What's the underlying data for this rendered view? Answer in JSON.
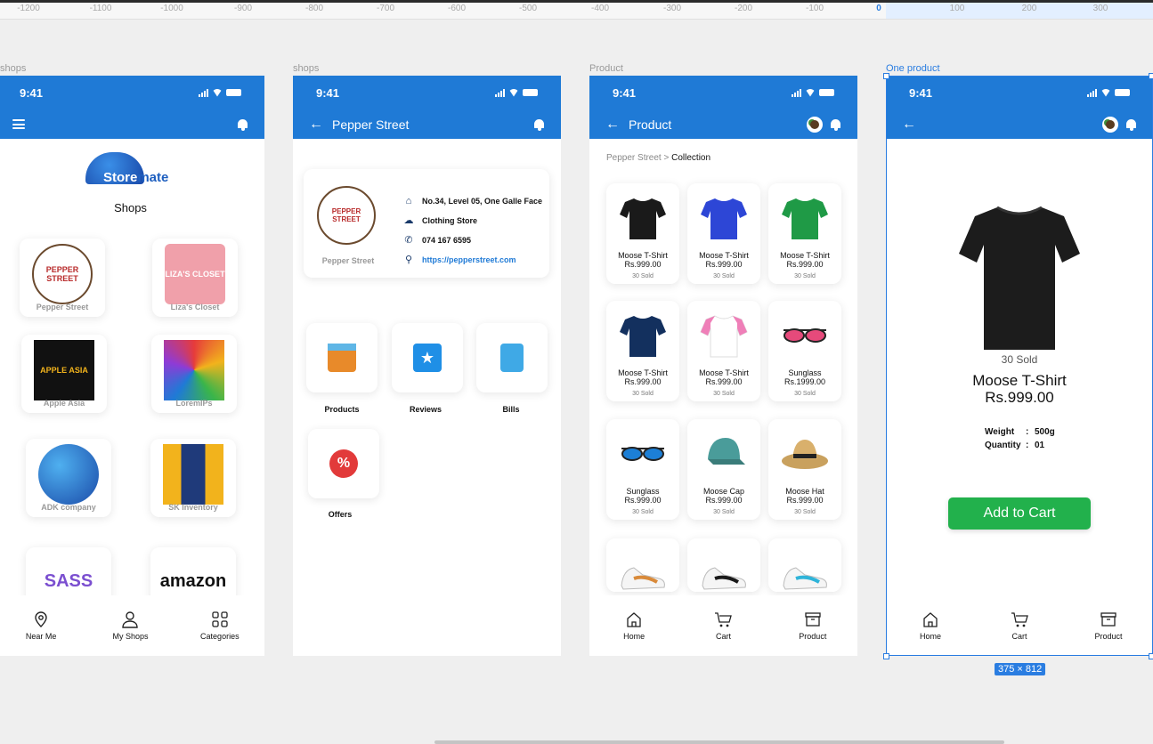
{
  "ruler": {
    "ticks": [
      "-1200",
      "-1100",
      "-1000",
      "-900",
      "-800",
      "-700",
      "-600",
      "-500",
      "-400",
      "-300",
      "-200",
      "-100",
      "0",
      "100",
      "200",
      "300"
    ]
  },
  "frames": [
    {
      "label": "shops"
    },
    {
      "label": "shops"
    },
    {
      "label": "Product"
    },
    {
      "label": "One product"
    }
  ],
  "status_time": "9:41",
  "colors": {
    "primary": "#1f7ad6",
    "cart_button": "#22b14c",
    "selection": "#2a7de1"
  },
  "home": {
    "logo_store": "Store",
    "logo_mate": "mate",
    "title": "Shops",
    "shops": [
      {
        "name": "Pepper Street",
        "logo_text": "PEPPER STREET"
      },
      {
        "name": "Liza's Closet",
        "logo_text": "LIZA'S CLOSET"
      },
      {
        "name": "Apple Asia",
        "logo_text": "APPLE ASIA"
      },
      {
        "name": "LoremIPs",
        "logo_text": ""
      },
      {
        "name": "ADK company",
        "logo_text": ""
      },
      {
        "name": "SK Inventory",
        "logo_text": ""
      },
      {
        "name": "",
        "logo_text": "SASS"
      },
      {
        "name": "",
        "logo_text": "amazon"
      }
    ],
    "nav": [
      {
        "label": "Near Me",
        "icon": "map-pin-icon"
      },
      {
        "label": "My Shops",
        "icon": "user-icon"
      },
      {
        "label": "Categories",
        "icon": "grid-icon"
      }
    ]
  },
  "shop_page": {
    "title": "Pepper Street",
    "logo_caption": "Pepper Street",
    "logo_text": "PEPPER STREET",
    "address": "No.34, Level 05, One Galle Face",
    "category": "Clothing Store",
    "phone": "074 167 6595",
    "website": "https://pepperstreet.com",
    "tiles": [
      {
        "label": "Products",
        "icon": "box-icon"
      },
      {
        "label": "Reviews",
        "icon": "star-chat-icon"
      },
      {
        "label": "Bills",
        "icon": "document-icon"
      },
      {
        "label": "Offers",
        "icon": "percent-icon"
      }
    ]
  },
  "product_list": {
    "title": "Product",
    "breadcrumb_parent": "Pepper Street",
    "breadcrumb_sep": ">",
    "breadcrumb_current": "Collection",
    "items": [
      {
        "name": "Moose T-Shirt",
        "price": "Rs.999.00",
        "sold": "30 Sold",
        "kind": "tshirt",
        "color": "#1a1a1a"
      },
      {
        "name": "Moose T-Shirt",
        "price": "Rs.999.00",
        "sold": "30 Sold",
        "kind": "polo",
        "color": "#2d46d6"
      },
      {
        "name": "Moose T-Shirt",
        "price": "Rs.999.00",
        "sold": "30 Sold",
        "kind": "tshirt",
        "color": "#1f9a46"
      },
      {
        "name": "Moose T-Shirt",
        "price": "Rs.999.00",
        "sold": "30 Sold",
        "kind": "tshirt",
        "color": "#13305e"
      },
      {
        "name": "Moose T-Shirt",
        "price": "Rs.999.00",
        "sold": "30 Sold",
        "kind": "tshirt",
        "color": "#ef7fb8"
      },
      {
        "name": "Sunglass",
        "price": "Rs.1999.00",
        "sold": "30 Sold",
        "kind": "glasses",
        "color": "#e64a7b"
      },
      {
        "name": "Sunglass",
        "price": "Rs.999.00",
        "sold": "30 Sold",
        "kind": "glasses",
        "color": "#1c7fd6"
      },
      {
        "name": "Moose Cap",
        "price": "Rs.999.00",
        "sold": "30 Sold",
        "kind": "cap",
        "color": "#4a9c9a"
      },
      {
        "name": "Moose Hat",
        "price": "Rs.999.00",
        "sold": "30 Sold",
        "kind": "hat",
        "color": "#c9a15e"
      },
      {
        "name": "",
        "price": "",
        "sold": "",
        "kind": "shoe",
        "color": "#d98a3a"
      },
      {
        "name": "",
        "price": "",
        "sold": "",
        "kind": "shoe",
        "color": "#1a1a1a"
      },
      {
        "name": "",
        "price": "",
        "sold": "",
        "kind": "shoe",
        "color": "#2fb4d9"
      }
    ],
    "nav": [
      {
        "label": "Home",
        "icon": "home-icon"
      },
      {
        "label": "Cart",
        "icon": "cart-icon"
      },
      {
        "label": "Product",
        "icon": "archive-icon"
      }
    ]
  },
  "product_detail": {
    "sold": "30 Sold",
    "name": "Moose T-Shirt",
    "price": "Rs.999.00",
    "weight_label": "Weight",
    "weight_value": "500g",
    "quantity_label": "Quantity",
    "quantity_value": "01",
    "colon": ":",
    "add_to_cart": "Add to Cart",
    "size_badge": "375 × 812",
    "nav": [
      {
        "label": "Home",
        "icon": "home-icon"
      },
      {
        "label": "Cart",
        "icon": "cart-icon"
      },
      {
        "label": "Product",
        "icon": "archive-icon"
      }
    ]
  }
}
